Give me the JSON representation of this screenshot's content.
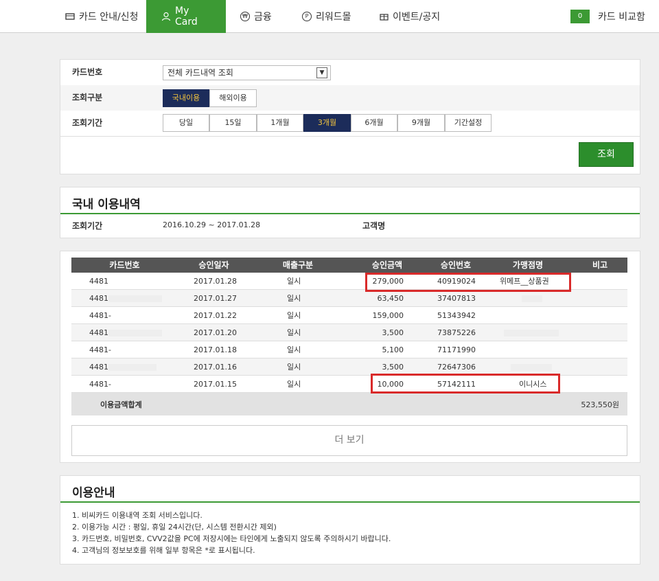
{
  "nav": {
    "items": [
      {
        "label": "카드 안내/신청",
        "icon": "card-icon"
      },
      {
        "label": "My Card",
        "icon": "person-icon"
      },
      {
        "label": "금융",
        "icon": "won-icon"
      },
      {
        "label": "리워드몰",
        "icon": "points-icon"
      },
      {
        "label": "이벤트/공지",
        "icon": "gift-icon"
      }
    ],
    "compare_count": "0",
    "compare_label": "카드 비교함"
  },
  "search": {
    "card_label": "카드번호",
    "card_select": "전체 카드내역 조회",
    "type_label": "조회구분",
    "type_options": [
      "국내이용",
      "해외이용"
    ],
    "period_label": "조회기간",
    "periods": [
      "당일",
      "15일",
      "1개월",
      "3개월",
      "6개월",
      "9개월",
      "기간설정"
    ],
    "submit": "조회"
  },
  "summary": {
    "title": "국내 이용내역",
    "period_label": "조회기간",
    "period_value": "2016.10.29 ~ 2017.01.28",
    "customer_label": "고객명"
  },
  "table": {
    "headers": [
      "카드번호",
      "승인일자",
      "매출구분",
      "승인금액",
      "승인번호",
      "가맹점명",
      "비고"
    ],
    "rows": [
      {
        "card": "4481",
        "date": "2017.01.28",
        "type": "일시",
        "amount": "279,000",
        "approval": "40919024",
        "merchant": "위메프__상품권"
      },
      {
        "card": "4481-",
        "date": "2017.01.27",
        "type": "일시",
        "amount": "63,450",
        "approval": "37407813",
        "merchant": ""
      },
      {
        "card": "4481-",
        "date": "2017.01.22",
        "type": "일시",
        "amount": "159,000",
        "approval": "51343942",
        "merchant": ""
      },
      {
        "card": "4481-",
        "date": "2017.01.20",
        "type": "일시",
        "amount": "3,500",
        "approval": "73875226",
        "merchant": ""
      },
      {
        "card": "4481-",
        "date": "2017.01.18",
        "type": "일시",
        "amount": "5,100",
        "approval": "71171990",
        "merchant": ""
      },
      {
        "card": "4481-",
        "date": "2017.01.16",
        "type": "일시",
        "amount": "3,500",
        "approval": "72647306",
        "merchant": ""
      },
      {
        "card": "4481-",
        "date": "2017.01.15",
        "type": "일시",
        "amount": "10,000",
        "approval": "57142111",
        "merchant": "이니시스"
      }
    ],
    "total_label": "이용금액합계",
    "total_value": "523,550원",
    "more": "더 보기"
  },
  "guide": {
    "title": "이용안내",
    "items": [
      "1.  비씨카드 이용내역 조회 서비스입니다.",
      "2.  이용가능 시간 : 평일, 휴일 24시간(단, 시스템 전환시간 제외)",
      "3.  카드번호, 비밀번호, CVV2값을 PC에 저장시에는 타인에게 노출되지 않도록 주의하시기 바랍니다.",
      "4.  고객님의 정보보호를 위해 일부 항목은 *로 표시됩니다."
    ]
  },
  "colors": {
    "accent": "#3c9a34",
    "selected": "#1c2c5a",
    "highlight": "#d92a2a"
  }
}
